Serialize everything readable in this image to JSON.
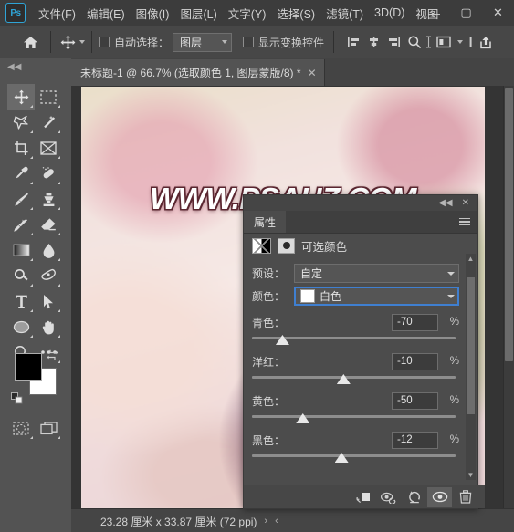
{
  "app": {
    "name": "Photoshop",
    "logo_text": "Ps"
  },
  "menubar": {
    "items": [
      {
        "label": "文件(F)",
        "name": "menu-file"
      },
      {
        "label": "编辑(E)",
        "name": "menu-edit"
      },
      {
        "label": "图像(I)",
        "name": "menu-image"
      },
      {
        "label": "图层(L)",
        "name": "menu-layer"
      },
      {
        "label": "文字(Y)",
        "name": "menu-type"
      },
      {
        "label": "选择(S)",
        "name": "menu-select"
      },
      {
        "label": "滤镜(T)",
        "name": "menu-filter"
      },
      {
        "label": "3D(D)",
        "name": "menu-3d"
      },
      {
        "label": "视图",
        "name": "menu-view"
      }
    ],
    "window_controls": {
      "minimize": "—",
      "maximize": "▢",
      "close": "✕"
    }
  },
  "options_bar": {
    "home_icon": "home-icon",
    "tool_icon": "move-tool-icon",
    "auto_select_label": "自动选择：",
    "auto_select_checked": false,
    "auto_select_scope": "图层",
    "show_transform_label": "显示变换控件",
    "show_transform_checked": false,
    "align_icons": [
      "align-left-icon",
      "align-vertical-center-icon",
      "align-right-icon"
    ],
    "extra_icons": [
      "search-icon",
      "text-cursor-icon",
      "arrange-icon",
      "chevron-down-icon",
      "divider-icon",
      "share-icon"
    ]
  },
  "toolbox": {
    "collapse_label": "◀◀",
    "tools": [
      {
        "name": "move-tool",
        "icon": "move-icon",
        "active": true
      },
      {
        "name": "rectangular-marquee-tool",
        "icon": "marquee-icon",
        "active": false
      },
      {
        "name": "lasso-tool",
        "icon": "lasso-icon",
        "active": false
      },
      {
        "name": "quick-selection-tool",
        "icon": "magic-wand-icon",
        "active": false
      },
      {
        "name": "crop-tool",
        "icon": "crop-icon",
        "active": false
      },
      {
        "name": "frame-tool",
        "icon": "frame-icon",
        "active": false
      },
      {
        "name": "eyedropper-tool",
        "icon": "eyedropper-icon",
        "active": false
      },
      {
        "name": "spot-healing-brush-tool",
        "icon": "healing-brush-icon",
        "active": false
      },
      {
        "name": "brush-tool",
        "icon": "brush-icon",
        "active": false
      },
      {
        "name": "clone-stamp-tool",
        "icon": "clone-stamp-icon",
        "active": false
      },
      {
        "name": "history-brush-tool",
        "icon": "history-brush-icon",
        "active": false
      },
      {
        "name": "eraser-tool",
        "icon": "eraser-icon",
        "active": false
      },
      {
        "name": "gradient-tool",
        "icon": "gradient-icon",
        "active": false
      },
      {
        "name": "blur-tool",
        "icon": "blur-drop-icon",
        "active": false
      },
      {
        "name": "dodge-tool",
        "icon": "dodge-icon",
        "active": false
      },
      {
        "name": "pen-tool",
        "icon": "pen-icon",
        "active": false
      },
      {
        "name": "horizontal-type-tool",
        "icon": "type-icon",
        "active": false
      },
      {
        "name": "path-selection-tool",
        "icon": "path-arrow-icon",
        "active": false
      },
      {
        "name": "ellipse-tool",
        "icon": "ellipse-icon",
        "active": false
      },
      {
        "name": "hand-tool",
        "icon": "hand-icon",
        "active": false
      },
      {
        "name": "zoom-tool",
        "icon": "zoom-icon",
        "active": false
      },
      {
        "name": "edit-toolbar",
        "icon": "ellipsis-icon",
        "active": false
      }
    ],
    "swatches": {
      "foreground_color": "#000000",
      "background_color": "#ffffff",
      "swap_icon": "swap-colors-icon",
      "default_icon": "default-colors-icon"
    },
    "bottom_tools": [
      {
        "name": "quick-mask-button",
        "icon": "quick-mask-icon"
      },
      {
        "name": "screen-mode-button",
        "icon": "screen-mode-icon"
      }
    ]
  },
  "document": {
    "tab_title": "未标题-1 @ 66.7% (选取颜色 1, 图层蒙版/8) *",
    "close_icon": "✕",
    "watermark_text": "WWW.PSAHZ.COM",
    "zoom_level": "66.7%"
  },
  "status_bar": {
    "dimensions": "23.28 厘米 x 33.87 厘米 (72 ppi)",
    "expand_icon": "›",
    "more_icon": "‹"
  },
  "properties_panel": {
    "collapse_icon": "◀◀",
    "close_icon": "✕",
    "tab_label": "属性",
    "menu_icon": "hamburger-menu-icon",
    "adjustment_icon": "selective-color-adjustment-icon",
    "mask_icon": "layer-mask-icon",
    "adjustment_title": "可选颜色",
    "preset_label": "预设：",
    "preset_value": "自定",
    "colors_label": "颜色：",
    "colors_value": "白色",
    "colors_swatch": "#ffffff",
    "sliders": [
      {
        "label": "青色：",
        "value": "-70",
        "unit": "%",
        "percent": 15,
        "name": "cyan-slider"
      },
      {
        "label": "洋红：",
        "value": "-10",
        "unit": "%",
        "percent": 45,
        "name": "magenta-slider"
      },
      {
        "label": "黄色：",
        "value": "-50",
        "unit": "%",
        "percent": 25,
        "name": "yellow-slider"
      },
      {
        "label": "黑色：",
        "value": "-12",
        "unit": "%",
        "percent": 44,
        "name": "black-slider"
      }
    ],
    "footer_buttons": [
      {
        "name": "clip-to-layer-button",
        "icon": "clip-to-layer-icon",
        "active": false
      },
      {
        "name": "view-previous-state-button",
        "icon": "eye-previous-icon",
        "active": false
      },
      {
        "name": "reset-adjustment-button",
        "icon": "reset-icon",
        "active": false
      },
      {
        "name": "toggle-visibility-button",
        "icon": "eye-icon",
        "active": true
      },
      {
        "name": "delete-adjustment-button",
        "icon": "trash-icon",
        "active": false
      }
    ]
  },
  "colors": {
    "menu_bg": "#3c3c3c",
    "options_bg": "#474747",
    "app_bg": "#535353",
    "panel_bg": "#4c4c4c",
    "canvas_bg": "#343434",
    "accent": "#2fa4d6",
    "focus_border": "#3f7fd0"
  }
}
